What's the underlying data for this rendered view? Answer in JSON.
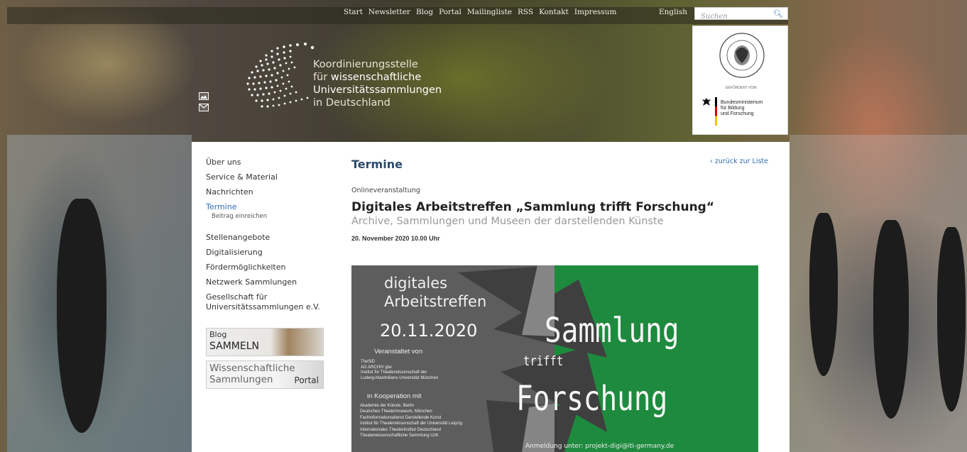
{
  "top_nav": {
    "links": [
      "Start",
      "Newsletter",
      "Blog",
      "Portal",
      "Mailingliste",
      "RSS",
      "Kontakt",
      "Impressum"
    ],
    "language": "English",
    "search_placeholder": "Suchen"
  },
  "logo": {
    "line1": "Koordinierungsstelle",
    "line2_a": "für ",
    "line2_b": "wissenschaftliche",
    "line3": "Universitätssammlungen",
    "line4": "in Deutschland"
  },
  "sponsor": {
    "funded_by": "GEFÖRDERT VOM",
    "ministry_line1": "Bundesministerium",
    "ministry_line2": "für Bildung",
    "ministry_line3": "und Forschung"
  },
  "sidebar": {
    "items": [
      "Über uns",
      "Service & Material",
      "Nachrichten"
    ],
    "active": "Termine",
    "active_sub": "Beitrag einreichen",
    "items2": [
      "Stellenangebote",
      "Digitalisierung",
      "Fördermöglichkeiten",
      "Netzwerk Sammlungen"
    ],
    "society_line1": "Gesellschaft für",
    "society_line2": "Universitätssammlungen e.V.",
    "blog_badge": {
      "line1": "Blog",
      "line2": "SAMMELN"
    },
    "ws_badge": {
      "line1": "Wissenschaftliche",
      "line2": "Sammlungen",
      "portal": "Portal"
    }
  },
  "content": {
    "section": "Termine",
    "back_link": "‹ zurück zur Liste",
    "kicker": "Onlineveranstaltung",
    "title": "Digitales Arbeitstreffen „Sammlung trifft Forschung“",
    "subtitle": "Archive, Sammlungen und Museen der darstellenden Künste",
    "date": "20. November 2020 10.00 Uhr"
  },
  "poster": {
    "title_line1": "digitales",
    "title_line2": "Arbeitstreffen",
    "date": "20.11.2020",
    "organized_by": "Veranstaltet von",
    "organizers": [
      "TheSiD",
      "AG ARCHIV gtw",
      "Institut für Theaterwissenschaft der",
      "Ludwig-Maximilians-Universität München"
    ],
    "cooperation": "in Kooperation mit",
    "partners": [
      "Akademie der Künste, Berlin",
      "Deutsches Theatermuseum, München",
      "Fachinformationsdienst Darstellende Kunst",
      "Institut für Theaterwissenschaft der Universität Leipzig",
      "Internationales Theaterinstitut Deutschland",
      "Theaterwissenschaftliche Sammlung UzK"
    ],
    "word1": "Sammlung",
    "word2": "trifft",
    "word3": "Forschung",
    "registration": "Anmeldung unter: projekt-digi@iti-germany.de"
  },
  "colors": {
    "accent": "#2f6eb0",
    "heading": "#2d4a6a",
    "poster_green": "#1e8a3e",
    "poster_gray": "#5d5d5d"
  }
}
